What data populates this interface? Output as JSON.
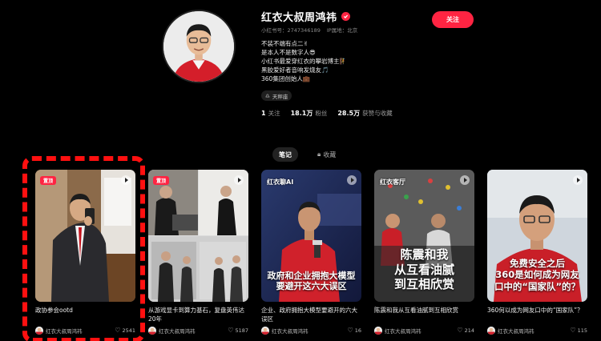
{
  "profile": {
    "name": "红衣大叔周鸿祎",
    "xhs_id": "小红书号：2747346189",
    "ip_location": "IP属地：北京",
    "bio": [
      "不装不端有点二✌",
      "是本人不是数字人😎",
      "小红书最爱穿红衣的攀岩博主🧗",
      "黑胶爱好者音响发烧友🎵",
      "360集团创始人💼"
    ],
    "tag": "天秤座",
    "follow_label": "关注",
    "stats": [
      {
        "value": "1",
        "label": "关注"
      },
      {
        "value": "18.1万",
        "label": "粉丝"
      },
      {
        "value": "28.5万",
        "label": "获赞与收藏"
      }
    ]
  },
  "tabs": [
    {
      "label": "笔记",
      "active": true
    },
    {
      "label": "收藏",
      "active": false
    }
  ],
  "posts": [
    {
      "pin": "置顶",
      "brand": "",
      "overlay": "",
      "title": "政协参会ootd",
      "author": "红衣大叔周鸿祎",
      "likes": "2541"
    },
    {
      "pin": "置顶",
      "brand": "",
      "overlay": "",
      "title": "从游戏显卡到算力基石，复盘英伟达20年",
      "author": "红衣大叔周鸿祎",
      "likes": "5187"
    },
    {
      "pin": "",
      "brand": "红衣聊AI",
      "overlay": "政府和企业拥抱大模型\n要避开这六大误区",
      "title": "企业、政府拥抱大模型要避开的六大误区",
      "author": "红衣大叔周鸿祎",
      "likes": "16"
    },
    {
      "pin": "",
      "brand": "红衣客厅",
      "overlay": "陈震和我\n从互看油腻\n到互相欣赏",
      "title": "陈震和我从互看油腻到互相欣赏",
      "author": "红衣大叔周鸿祎",
      "likes": "214"
    },
    {
      "pin": "",
      "brand": "",
      "overlay": "免费安全之后\n360是如何成为网友\n口中的“国家队”的？",
      "title": "360何以成为网友口中的“国家队”？",
      "author": "红衣大叔周鸿祎",
      "likes": "115"
    }
  ],
  "colors": {
    "accent": "#ff2442",
    "highlight_box": "#ff1010"
  }
}
